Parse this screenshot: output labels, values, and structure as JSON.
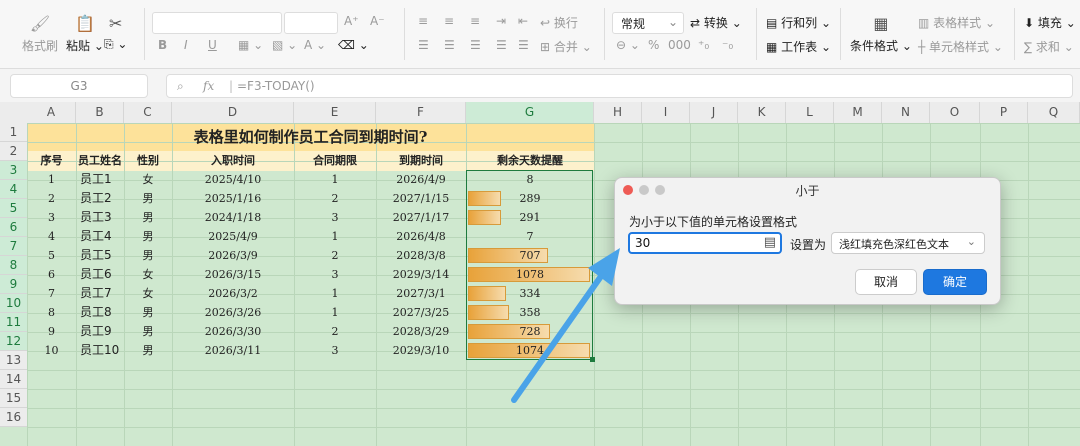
{
  "ribbon": {
    "format_painter": "格式刷",
    "paste": "粘贴",
    "wrap": "换行",
    "merge": "合并",
    "number_format": "常规",
    "convert": "转换",
    "rows_cols": "行和列",
    "worksheet": "工作表",
    "cond_format": "条件格式",
    "table_style": "表格样式",
    "cell_style": "单元格样式",
    "fill": "填充",
    "sum": "求和",
    "bold": "B",
    "italic": "I",
    "underline": "U"
  },
  "formula_bar": {
    "cell_ref": "G3",
    "fx": "fx",
    "formula": "=F3-TODAY()"
  },
  "sheet": {
    "columns": [
      "A",
      "B",
      "C",
      "D",
      "E",
      "F",
      "G",
      "H",
      "I",
      "J",
      "K",
      "L",
      "M",
      "N",
      "O",
      "P",
      "Q"
    ],
    "rows": [
      "1",
      "2",
      "3",
      "4",
      "5",
      "6",
      "7",
      "8",
      "9",
      "10",
      "11",
      "12",
      "13",
      "14",
      "15",
      "16"
    ],
    "title": "表格里如何制作员工合同到期时间?",
    "headers": [
      "序号",
      "员工姓名",
      "性别",
      "入职时间",
      "合同期限",
      "到期时间",
      "剩余天数提醒"
    ],
    "data": [
      [
        "1",
        "员工1",
        "女",
        "2025/4/10",
        "1",
        "2026/4/9",
        "8"
      ],
      [
        "2",
        "员工2",
        "男",
        "2025/1/16",
        "2",
        "2027/1/15",
        "289"
      ],
      [
        "3",
        "员工3",
        "男",
        "2024/1/18",
        "3",
        "2027/1/17",
        "291"
      ],
      [
        "4",
        "员工4",
        "男",
        "2025/4/9",
        "1",
        "2026/4/8",
        "7"
      ],
      [
        "5",
        "员工5",
        "男",
        "2026/3/9",
        "2",
        "2028/3/8",
        "707"
      ],
      [
        "6",
        "员工6",
        "女",
        "2026/3/15",
        "3",
        "2029/3/14",
        "1078"
      ],
      [
        "7",
        "员工7",
        "女",
        "2026/3/2",
        "1",
        "2027/3/1",
        "334"
      ],
      [
        "8",
        "员工8",
        "男",
        "2026/3/26",
        "1",
        "2027/3/25",
        "358"
      ],
      [
        "9",
        "员工9",
        "男",
        "2026/3/30",
        "2",
        "2028/3/29",
        "728"
      ],
      [
        "10",
        "员工10",
        "男",
        "2026/3/11",
        "3",
        "2029/3/10",
        "1074"
      ]
    ],
    "databar_max": 1078
  },
  "dialog": {
    "title": "小于",
    "prompt": "为小于以下值的单元格设置格式",
    "value": "30",
    "set_as_label": "设置为",
    "format_option": "浅红填充色深红色文本",
    "cancel": "取消",
    "ok": "确定"
  },
  "colors": {
    "accent": "#1e78e0",
    "sheet_bg": "#cfe8cf",
    "title_bg": "#fde29a",
    "header_bg": "#fdf1cc",
    "bar": "#e8a23a"
  }
}
